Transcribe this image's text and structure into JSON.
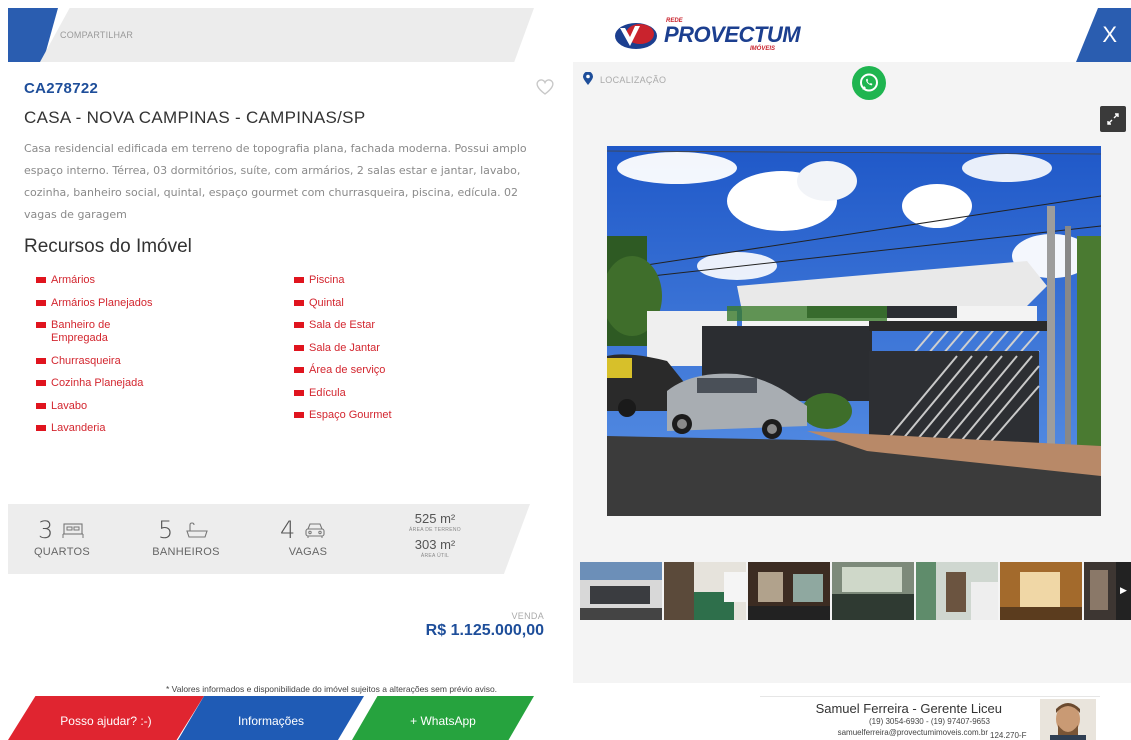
{
  "header": {
    "share_label": "COMPARTILHAR",
    "logo": {
      "rede": "REDE",
      "brand": "PROVECTUM",
      "sub": "IMÓVEIS"
    },
    "close_label": "X"
  },
  "property": {
    "code": "CA278722",
    "title": "CASA - NOVA CAMPINAS - CAMPINAS/SP",
    "description": "Casa residencial edificada em terreno de topografia plana, fachada moderna. Possui amplo espaço interno. Térrea, 03 dormitórios, suíte, com armários, 2 salas estar e jantar, lavabo, cozinha, banheiro social, quintal, espaço gourmet com churrasqueira, piscina, edícula. 02 vagas de garagem"
  },
  "features": {
    "title": "Recursos do Imóvel",
    "col1": [
      "Armários",
      "Armários Planejados",
      "Banheiro de Empregada",
      "Churrasqueira",
      "Cozinha Planejada",
      "Lavabo",
      "Lavanderia"
    ],
    "col2": [
      "Piscina",
      "Quintal",
      "Sala de Estar",
      "Sala de Jantar",
      "Área de serviço",
      "Edícula",
      "Espaço Gourmet"
    ]
  },
  "stats": {
    "quartos": {
      "value": "3",
      "label": "QUARTOS"
    },
    "banheiros": {
      "value": "5",
      "label": "BANHEIROS"
    },
    "vagas": {
      "value": "4",
      "label": "VAGAS"
    },
    "area_terreno": {
      "value": "525 m²",
      "label": "ÁREA DE TERRENO"
    },
    "area_util": {
      "value": "303 m²",
      "label": "ÁREA ÚTIL"
    }
  },
  "price": {
    "type": "VENDA",
    "value": "R$ 1.125.000,00"
  },
  "location": {
    "label": "LOCALIZAÇÃO"
  },
  "disclaimer": "* Valores informados e disponibilidade do imóvel sujeitos a alterações sem prévio aviso.",
  "actions": {
    "help": "Posso ajudar? :-)",
    "info": "Informações",
    "whatsapp": "+ WhatsApp"
  },
  "agent": {
    "name": "Samuel Ferreira - Gerente Liceu",
    "phones": "(19) 3054-6930 - (19) 97407-9653",
    "email": "samuelferreira@provectumimoveis.com.br",
    "code": "124.270-F"
  },
  "colors": {
    "brand_blue": "#1e4e9a",
    "accent_red": "#e0141e",
    "whatsapp_green": "#26a33e"
  },
  "icons": [
    "heart-icon",
    "bed-icon",
    "bathtub-icon",
    "car-icon",
    "location-pin-icon",
    "whatsapp-icon",
    "expand-icon",
    "chevron-right-icon",
    "close-icon"
  ]
}
